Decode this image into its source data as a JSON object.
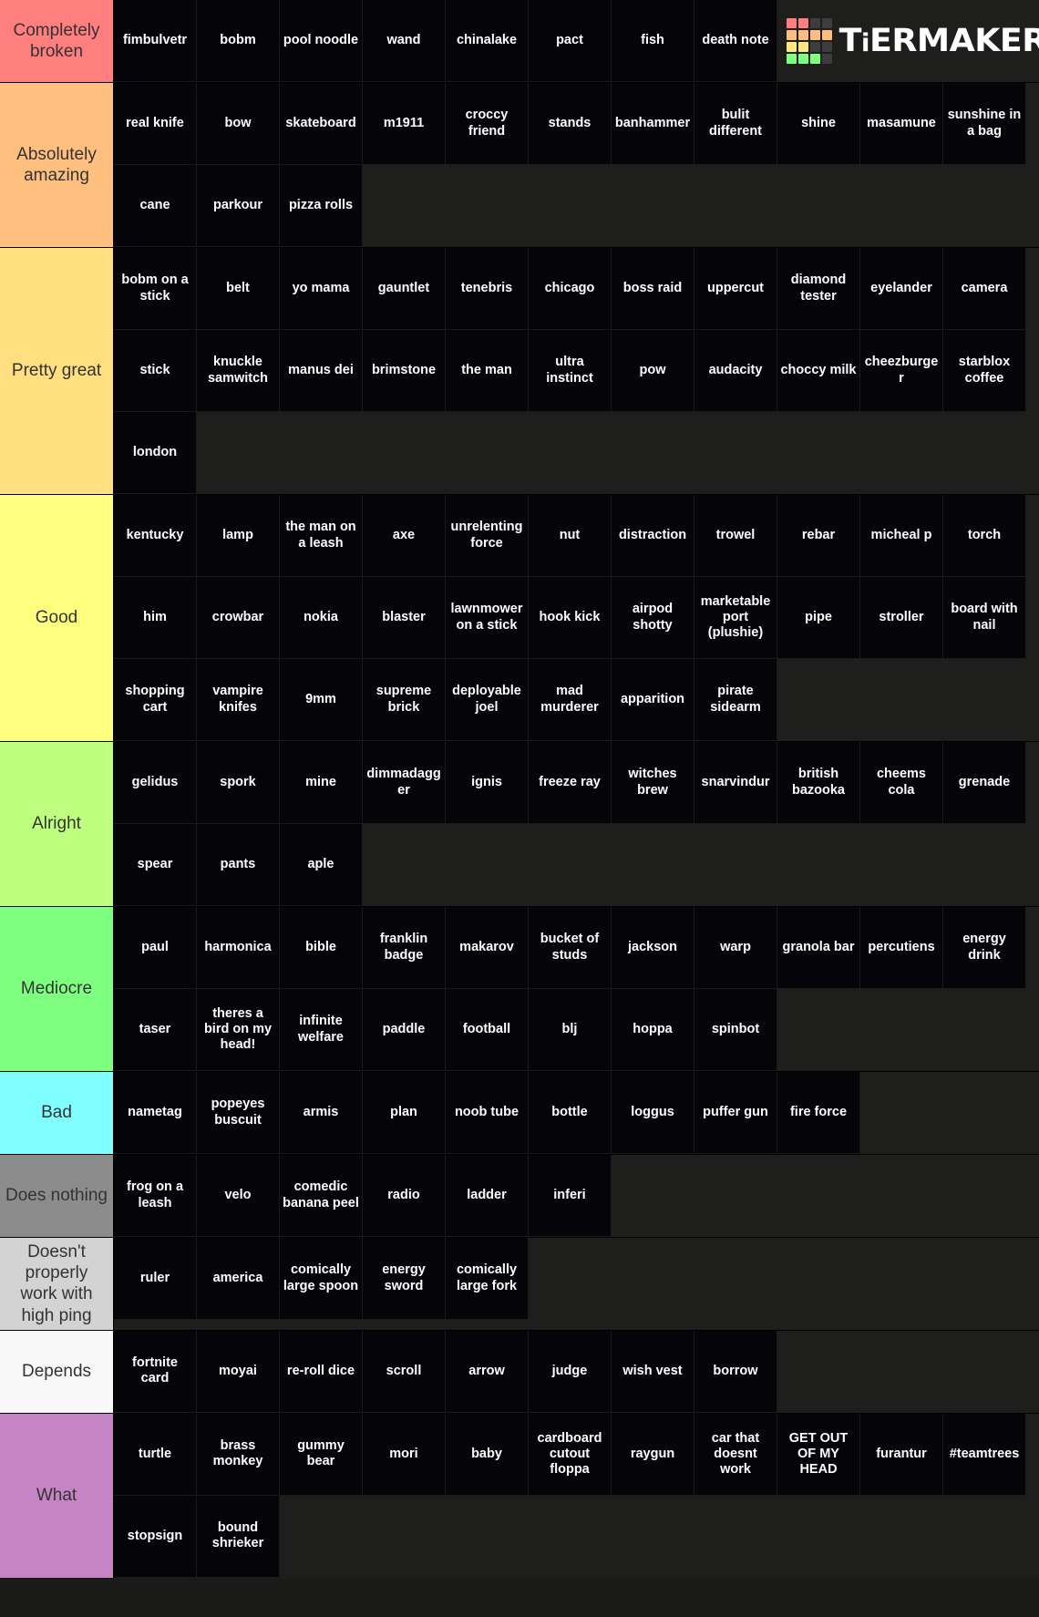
{
  "logo": {
    "name": "tiermaker-logo",
    "text_upper_t": "T",
    "text_lower_i": "i",
    "text_rest": "ERMAKER",
    "full_text": "TiERMAKER",
    "grid_colors": [
      "#ff7f7f",
      "#ff7f7f",
      "#3d3d3d",
      "#3d3d3d",
      "#ffbe7f",
      "#ffbe7f",
      "#ffbe7f",
      "#ffbe7f",
      "#ffe97f",
      "#ffe97f",
      "#3d3d3d",
      "#3d3d3d",
      "#7fff7f",
      "#7fff7f",
      "#7fff7f",
      "#3d3d3d"
    ]
  },
  "tiers": [
    {
      "label": "Completely broken",
      "color": "#ff7f7f",
      "items": [
        "fimbulvetr",
        "bobm",
        "pool noodle",
        "wand",
        "chinalake",
        "pact",
        "fish",
        "death note"
      ]
    },
    {
      "label": "Absolutely amazing",
      "color": "#ffbf7f",
      "items": [
        "real knife",
        "bow",
        "skateboard",
        "m1911",
        "croccy friend",
        "stands",
        "banhammer",
        "bulit different",
        "shine",
        "masamune",
        "sunshine in a bag",
        "cane",
        "parkour",
        "pizza rolls"
      ]
    },
    {
      "label": "Pretty great",
      "color": "#ffdf80",
      "items": [
        "bobm on a stick",
        "belt",
        "yo mama",
        "gauntlet",
        "tenebris",
        "chicago",
        "boss raid",
        "uppercut",
        "diamond tester",
        "eyelander",
        "camera",
        "stick",
        "knuckle samwitch",
        "manus dei",
        "brimstone",
        "the man",
        "ultra instinct",
        "pow",
        "audacity",
        "choccy milk",
        "cheezburger",
        "starblox coffee",
        "london"
      ]
    },
    {
      "label": "Good",
      "color": "#ffff7f",
      "items": [
        "kentucky",
        "lamp",
        "the man on a leash",
        "axe",
        "unrelenting force",
        "nut",
        "distraction",
        "trowel",
        "rebar",
        "micheal p",
        "torch",
        "him",
        "crowbar",
        "nokia",
        "blaster",
        "lawnmower on a stick",
        "hook kick",
        "airpod shotty",
        "marketable port (plushie)",
        "pipe",
        "stroller",
        "board with nail",
        "shopping cart",
        "vampire knifes",
        "9mm",
        "supreme brick",
        "deployable joel",
        "mad murderer",
        "apparition",
        "pirate sidearm"
      ]
    },
    {
      "label": "Alright",
      "color": "#bfff7f",
      "items": [
        "gelidus",
        "spork",
        "mine",
        "dimmadagger",
        "ignis",
        "freeze ray",
        "witches brew",
        "snarvindur",
        "british bazooka",
        "cheems cola",
        "grenade",
        "spear",
        "pants",
        "aple"
      ]
    },
    {
      "label": "Mediocre",
      "color": "#7fff7f",
      "items": [
        "paul",
        "harmonica",
        "bible",
        "franklin badge",
        "makarov",
        "bucket of studs",
        "jackson",
        "warp",
        "granola bar",
        "percutiens",
        "energy drink",
        "taser",
        "theres a bird on my head!",
        "infinite welfare",
        "paddle",
        "football",
        "blj",
        "hoppa",
        "spinbot"
      ]
    },
    {
      "label": "Bad",
      "color": "#7fffff",
      "items": [
        "nametag",
        "popeyes buscuit",
        "armis",
        "plan",
        "noob tube",
        "bottle",
        "loggus",
        "puffer gun",
        "fire force"
      ]
    },
    {
      "label": "Does nothing",
      "color": "#8c8c8c",
      "items": [
        "frog on a leash",
        "velo",
        "comedic banana peel",
        "radio",
        "ladder",
        "inferi"
      ]
    },
    {
      "label": "Doesn't properly work with high ping",
      "color": "#d3d3d3",
      "items": [
        "ruler",
        "america",
        "comically large spoon",
        "energy sword",
        "comically large fork"
      ]
    },
    {
      "label": "Depends",
      "color": "#f8f8f8",
      "items": [
        "fortnite card",
        "moyai",
        "re-roll dice",
        "scroll",
        "arrow",
        "judge",
        "wish vest",
        "borrow"
      ]
    },
    {
      "label": "What",
      "color": "#c585c5",
      "items": [
        "turtle",
        "brass monkey",
        "gummy bear",
        "mori",
        "baby",
        "cardboard cutout floppa",
        "raygun",
        "car that doesnt work",
        "GET OUT OF MY HEAD",
        "furantur",
        "#teamtrees",
        "stopsign",
        "bound shrieker"
      ]
    }
  ]
}
